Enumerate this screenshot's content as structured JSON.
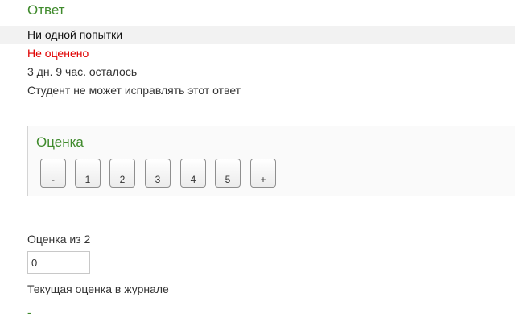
{
  "submission": {
    "heading": "Ответ",
    "attempt_status": "Ни одной попытки",
    "grading_status": "Не оценено",
    "time_remaining": "3 дн. 9 час. осталось",
    "editing_status": "Студент не может исправлять этот ответ"
  },
  "grade": {
    "heading": "Оценка",
    "options": [
      "-",
      "1",
      "2",
      "3",
      "4",
      "5",
      "+"
    ],
    "out_of_label": "Оценка из 2",
    "value": "0",
    "current_gradebook_label": "Текущая оценка в журнале",
    "current_gradebook_value": "-"
  },
  "colors": {
    "heading_green": "#3f8a2c",
    "not_graded_red": "#e00000",
    "status_row_bg": "#f2f2f2"
  }
}
